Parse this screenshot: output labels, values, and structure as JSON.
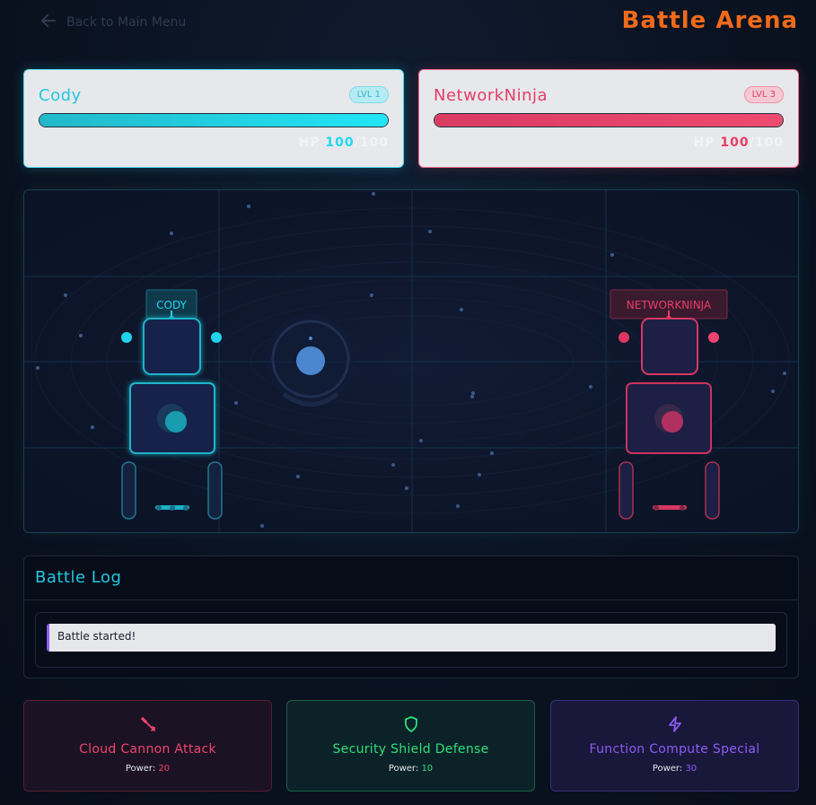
{
  "header": {
    "back_label": "Back to Main Menu",
    "title": "Battle Arena"
  },
  "players": [
    {
      "name": "Cody",
      "level": "LVL 1",
      "hp_label": "HP",
      "hp": "100",
      "hp_max": "/100",
      "hp_fraction": 1.0,
      "arena_tag": "CODY"
    },
    {
      "name": "NetworkNinja",
      "level": "LVL 3",
      "hp_label": "HP",
      "hp": "100",
      "hp_max": "/100",
      "hp_fraction": 1.0,
      "arena_tag": "NETWORKNINJA"
    }
  ],
  "battle_log": {
    "title": "Battle Log",
    "entries": [
      "Battle started!"
    ]
  },
  "actions": [
    {
      "name": "Cloud Cannon Attack",
      "power_label": "Power:",
      "power": "20",
      "icon": "sword-icon",
      "color": "#f0436e"
    },
    {
      "name": "Security Shield Defense",
      "power_label": "Power:",
      "power": "10",
      "icon": "shield-icon",
      "color": "#2ee07a"
    },
    {
      "name": "Function Compute Special",
      "power_label": "Power:",
      "power": "30",
      "icon": "lightning-icon",
      "color": "#8b5cf6"
    }
  ],
  "colors": {
    "cyan": "#22d3ee",
    "red": "#f43f5e",
    "orange": "#f06a1a",
    "purple": "#8b5cf6",
    "green": "#2ee07a"
  }
}
